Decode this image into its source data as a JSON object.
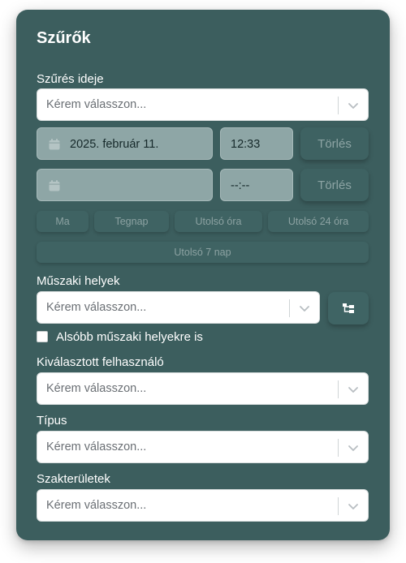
{
  "filters": {
    "title": "Szűrők",
    "time": {
      "label": "Szűrés ideje",
      "select_placeholder": "Kérem válasszon...",
      "from": {
        "date": "2025. február 11.",
        "time": "12:33",
        "clear_label": "Törlés"
      },
      "to": {
        "date": "",
        "time": "--:--",
        "clear_label": "Törlés"
      },
      "quick_ranges": [
        "Ma",
        "Tegnap",
        "Utolsó óra",
        "Utolsó 24 óra",
        "Utolsó 7 nap"
      ]
    },
    "locations": {
      "label": "Műszaki helyek",
      "placeholder": "Kérem válasszon...",
      "tree_icon": "hierarchy-icon",
      "include_sub_label": "Alsóbb műszaki helyekre is",
      "include_sub_checked": false
    },
    "user": {
      "label": "Kiválasztott felhasználó",
      "placeholder": "Kérem válasszon..."
    },
    "type": {
      "label": "Típus",
      "placeholder": "Kérem válasszon..."
    },
    "fields": {
      "label": "Szakterületek",
      "placeholder": "Kérem válasszon..."
    }
  },
  "colors": {
    "panel_bg": "#3c5e5e",
    "disabled_field": "#8ea6a6",
    "ghost_text": "#8da4a4"
  }
}
